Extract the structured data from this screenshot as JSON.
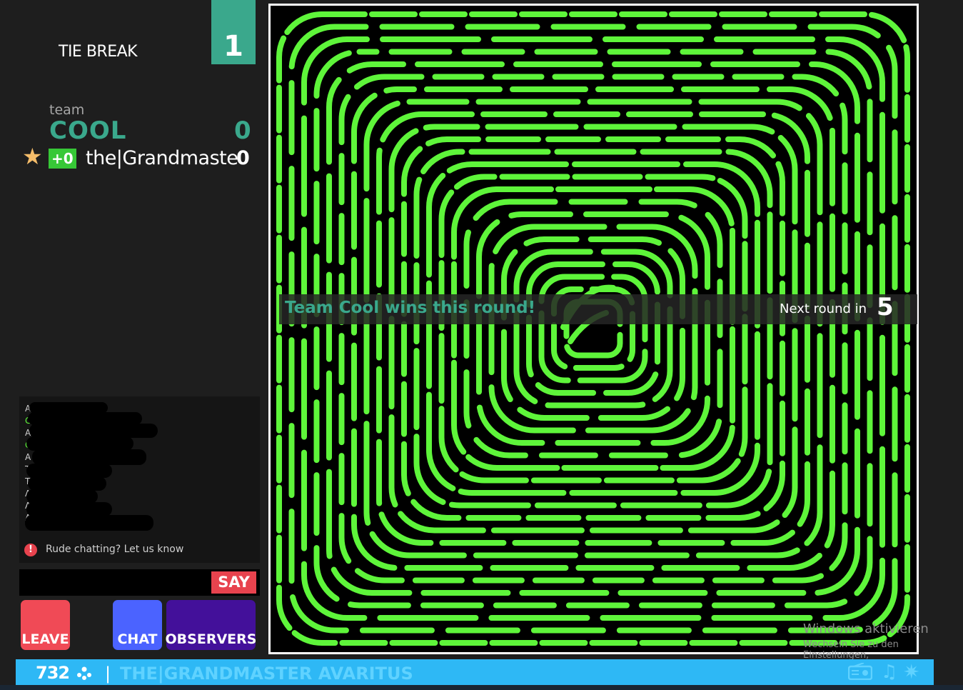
{
  "round": {
    "label": "TIE BREAK",
    "number": "1"
  },
  "team": {
    "prefix": "team",
    "name": "COOL",
    "score": "0"
  },
  "players": [
    {
      "delta": "+0",
      "name": "the|Grandmaste",
      "score": "0"
    }
  ],
  "chat": {
    "visible_lines": [
      "A",
      "G",
      "A",
      "G",
      "A",
      "T",
      "T",
      "A",
      "A",
      "A"
    ],
    "report_text": "Rude chatting? Let us know",
    "input_value": "",
    "say_label": "SAY"
  },
  "buttons": {
    "leave": "LEAVE",
    "chat": "CHAT",
    "observers": "OBSERVERS"
  },
  "round_result": {
    "message": "Team Cool wins this round!",
    "next_label": "Next round in",
    "countdown": "5"
  },
  "watermark": {
    "title": "Windows aktivieren",
    "subtitle": "Wechseln Sie zu den Einstellungen,"
  },
  "status_bar": {
    "online_count": "732",
    "title": "THE|GRANDMASTER AVARITUS"
  },
  "icons": [
    "star-icon",
    "alert-icon",
    "users-icon",
    "radio-icon",
    "music-icon",
    "effects-icon"
  ],
  "colors": {
    "teal": "#3aa88c",
    "green_line": "#5ef53a",
    "leave": "#f04a56",
    "chat": "#4b63ff",
    "observers": "#43109a",
    "status_bar": "#2eb8f5"
  }
}
